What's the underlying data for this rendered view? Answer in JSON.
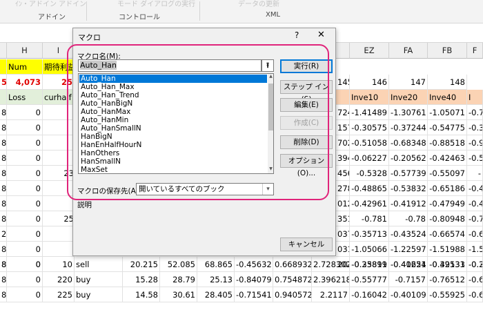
{
  "ribbon": {
    "faded_1": "ｲﾝ・アドイン アドイン",
    "faded_2": "モード  ダイアログの実行",
    "faded_3": "データの更新",
    "groups": {
      "addin": "アドイン",
      "control": "コントロール",
      "xml": "XML"
    }
  },
  "sheet": {
    "col_headers": {
      "H": "H",
      "I": "I",
      "EZ": "EZ",
      "FA": "FA",
      "FB": "FB",
      "FC": "F"
    },
    "row1": {
      "H": "Num",
      "I": "期待利益"
    },
    "row2": {
      "G": "5",
      "H": "4,073",
      "I": "25",
      "EY": "145",
      "EZ": "146",
      "FA": "147",
      "FB": "148"
    },
    "row3": {
      "H": "Loss",
      "I": "curhalf",
      "EZ": "Inve10",
      "FA": "Inve20",
      "FB": "Inve40",
      "FC": "I"
    },
    "rows": [
      {
        "g": "8",
        "h": "0",
        "ey": "724",
        "ez": "-1.41489",
        "fa": "-1.30761",
        "fb": "-1.05071",
        "fc": "-0.7"
      },
      {
        "g": "8",
        "h": "0",
        "ey": "157",
        "ez": "-0.30575",
        "fa": "-0.37244",
        "fb": "-0.54775",
        "fc": "-0.3"
      },
      {
        "g": "8",
        "h": "0",
        "ey": "702",
        "ez": "-0.51058",
        "fa": "-0.68348",
        "fb": "-0.88518",
        "fc": "-0.9"
      },
      {
        "g": "8",
        "h": "0",
        "ey": "394",
        "ez": "-0.06227",
        "fa": "-0.20562",
        "fb": "-0.42463",
        "fc": "-0.5"
      },
      {
        "g": "8",
        "h": "0",
        "ey": "456",
        "ez": "-0.5328",
        "fa": "-0.57739",
        "fb": "-0.55097",
        "fc": "-"
      },
      {
        "g": "8",
        "h": "0",
        "ey": "278",
        "ez": "-0.48865",
        "fa": "-0.53832",
        "fb": "-0.65186",
        "fc": "-0.4"
      },
      {
        "g": "8",
        "h": "0",
        "ey": "012",
        "ez": "-0.42961",
        "fa": "-0.41912",
        "fb": "-0.47949",
        "fc": "-0.4"
      },
      {
        "g": "8",
        "h": "0",
        "ey": "351",
        "ez": "-0.781",
        "fa": "-0.78",
        "fb": "-0.80948",
        "fc": "-0.7"
      },
      {
        "g": "2",
        "h": "0",
        "ey": "037",
        "ez": "-0.35713",
        "fa": "-0.43524",
        "fb": "-0.66574",
        "fc": "-0.6"
      },
      {
        "g": "8",
        "h": "0",
        "ey": "031",
        "ez": "-1.05066",
        "fa": "-1.22597",
        "fb": "-1.51988",
        "fc": "-1.5"
      },
      {
        "g": "8",
        "h": "0",
        "ey": "202",
        "ez": "-0.35819",
        "fa": "-0.40621",
        "fb": "-0.39131",
        "fc": "-0.2"
      }
    ],
    "bottom_rows": [
      {
        "g": "8",
        "h": "0",
        "i": "10",
        "j": "sell",
        "k": "20.215",
        "l": "52.085",
        "m": "68.865",
        "n": "-0.45632",
        "o": "0.668932",
        "p": "2.728302",
        "ez": "-0.23891",
        "fa": "-0.41254",
        "fb": "-0.42533",
        "fc": "-0.3"
      },
      {
        "g": "8",
        "h": "0",
        "i": "220",
        "j": "buy",
        "k": "15.28",
        "l": "28.79",
        "m": "25.13",
        "n": "-0.84079",
        "o": "0.754872",
        "p": "2.396218",
        "ez": "-0.55777",
        "fa": "-0.7157",
        "fb": "-0.76512",
        "fc": "-0.6"
      },
      {
        "g": "8",
        "h": "0",
        "i": "225",
        "j": "buy",
        "k": "14.58",
        "l": "30.61",
        "m": "28.405",
        "n": "-0.71541",
        "o": "0.940572",
        "p": "2.2117",
        "ez": "-0.16042",
        "fa": "-0.40109",
        "fb": "-0.55925",
        "fc": "-0.6"
      }
    ],
    "row_g_hidden": [
      "25",
      "23"
    ]
  },
  "dialog": {
    "title": "マクロ",
    "help": "?",
    "close": "✕",
    "name_label": "マクロ名(M):",
    "name_value": "Auto_Han",
    "macros": [
      "Auto_Han",
      "Auto_Han_Max",
      "Auto_Han_Trend",
      "Auto_HanBigN",
      "Auto_HanMax",
      "Auto_HanMin",
      "Auto_HanSmallN",
      "HanBigN",
      "HanEnHalfHourN",
      "HanOthers",
      "HanSmallN",
      "MaxSet"
    ],
    "store_label": "マクロの保存先(A):",
    "store_value": "開いているすべてのブック",
    "desc_label": "説明",
    "buttons": {
      "run": "実行(R)",
      "step": "ステップ イン(S)",
      "edit": "編集(E)",
      "create": "作成(C)",
      "delete": "削除(D)",
      "options": "オプション(O)...",
      "cancel": "キャンセル"
    }
  }
}
